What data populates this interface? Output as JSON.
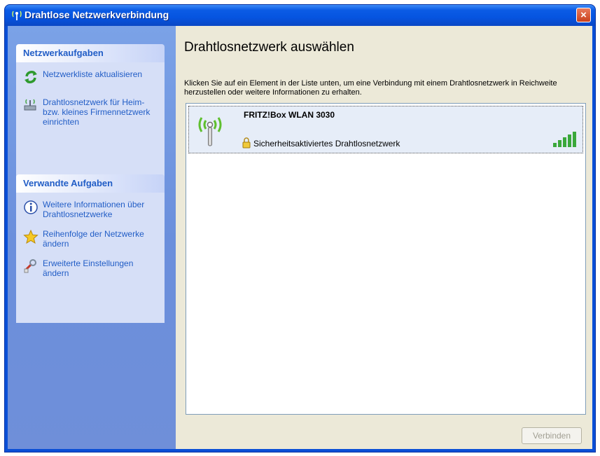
{
  "window": {
    "title": "Drahtlose Netzwerkverbindung",
    "close_label": "×"
  },
  "sidebar": {
    "network_tasks": {
      "title": "Netzwerkaufgaben",
      "items": [
        {
          "label": "Netzwerkliste aktualisieren",
          "icon": "refresh-icon"
        },
        {
          "label": "Drahtlosnetzwerk für Heim- bzw. kleines Firmennetzwerk einrichten",
          "icon": "wireless-setup-icon"
        }
      ]
    },
    "related_tasks": {
      "title": "Verwandte Aufgaben",
      "items": [
        {
          "label": "Weitere Informationen über Drahtlosnetzwerke",
          "icon": "info-icon"
        },
        {
          "label": "Reihenfolge der Netzwerke ändern",
          "icon": "star-icon"
        },
        {
          "label": "Erweiterte Einstellungen ändern",
          "icon": "advanced-settings-icon"
        }
      ]
    }
  },
  "main": {
    "title": "Drahtlosnetzwerk auswählen",
    "instructions": "Klicken Sie auf ein Element in der Liste unten, um eine Verbindung mit einem Drahtlosnetzwerk in Reichweite herzustellen oder weitere Informationen zu erhalten.",
    "networks": [
      {
        "name": "FRITZ!Box WLAN 3030",
        "status": "Sicherheitsaktiviertes Drahtlosnetzwerk",
        "signal_bars": 5,
        "signal_max": 5
      }
    ],
    "connect_label": "Verbinden"
  },
  "colors": {
    "titlebar": "#0654e0",
    "sidebar": "#6f8fd9",
    "link": "#215dc6",
    "signal": "#3aa83a"
  }
}
